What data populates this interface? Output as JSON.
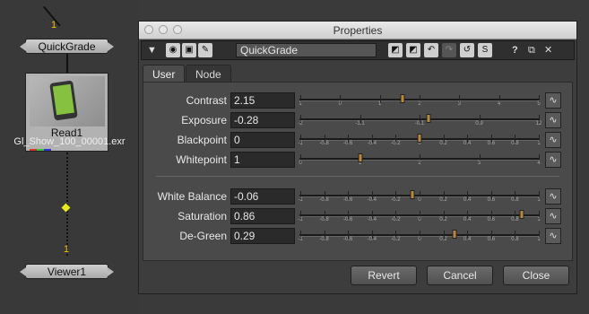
{
  "node_graph": {
    "quickgrade_node": "QuickGrade",
    "read_node": {
      "name": "Read1",
      "file": "Gl_Show_100_00001.exr"
    },
    "viewer_node": "Viewer1",
    "input_number_top": "1",
    "input_number_bottom": "1"
  },
  "dialog": {
    "title": "Properties",
    "toolbar": {
      "node_name": "QuickGrade",
      "help_label": "?",
      "s_label": "S"
    },
    "tabs": [
      {
        "label": "User"
      },
      {
        "label": "Node"
      }
    ],
    "knobs": [
      {
        "label": "Contrast",
        "value": "2.15",
        "handle": 2.15,
        "min": 0,
        "max": 5,
        "ticks": [
          "1",
          "0",
          "1",
          "2",
          "3",
          "4",
          "5"
        ],
        "tick_positions": [
          -1,
          0,
          1,
          2,
          3,
          4,
          5
        ]
      },
      {
        "label": "Exposure",
        "value": "-0.28",
        "handle": -0.28,
        "min": -2,
        "max": 1.2,
        "ticks": [
          "-2",
          "-1.1",
          "-0.1",
          "0.9",
          "12"
        ]
      },
      {
        "label": "Blackpoint",
        "value": "0",
        "handle": 0,
        "min": -1,
        "max": 1,
        "ticks": [
          "-1",
          "-0.8",
          "-0.6",
          "-0.4",
          "-0.2",
          "0",
          "0.2",
          "0.4",
          "0.6",
          "0.8",
          "1"
        ]
      },
      {
        "label": "Whitepoint",
        "value": "1",
        "handle": 1,
        "min": 0,
        "max": 4,
        "ticks": [
          "0",
          "1",
          "2",
          "3",
          "4"
        ]
      },
      {
        "label": "White Balance",
        "value": "-0.06",
        "handle": -0.06,
        "min": -1,
        "max": 1,
        "ticks": [
          "-1",
          "-0.8",
          "-0.6",
          "-0.4",
          "-0.2",
          "0",
          "0.2",
          "0.4",
          "0.6",
          "0.8",
          "1"
        ]
      },
      {
        "label": "Saturation",
        "value": "0.86",
        "handle": 0.86,
        "min": -1,
        "max": 1,
        "ticks": [
          "-1",
          "-0.8",
          "-0.6",
          "-0.4",
          "-0.2",
          "0",
          "0.2",
          "0.4",
          "0.6",
          "0.8",
          "1"
        ]
      },
      {
        "label": "De-Green",
        "value": "0.29",
        "handle": 0.29,
        "min": -1,
        "max": 1,
        "ticks": [
          "-1",
          "-0.8",
          "-0.6",
          "-0.4",
          "-0.2",
          "0",
          "0.2",
          "0.4",
          "0.6",
          "0.8",
          "1"
        ]
      }
    ],
    "buttons": {
      "revert": "Revert",
      "cancel": "Cancel",
      "close": "Close"
    }
  }
}
